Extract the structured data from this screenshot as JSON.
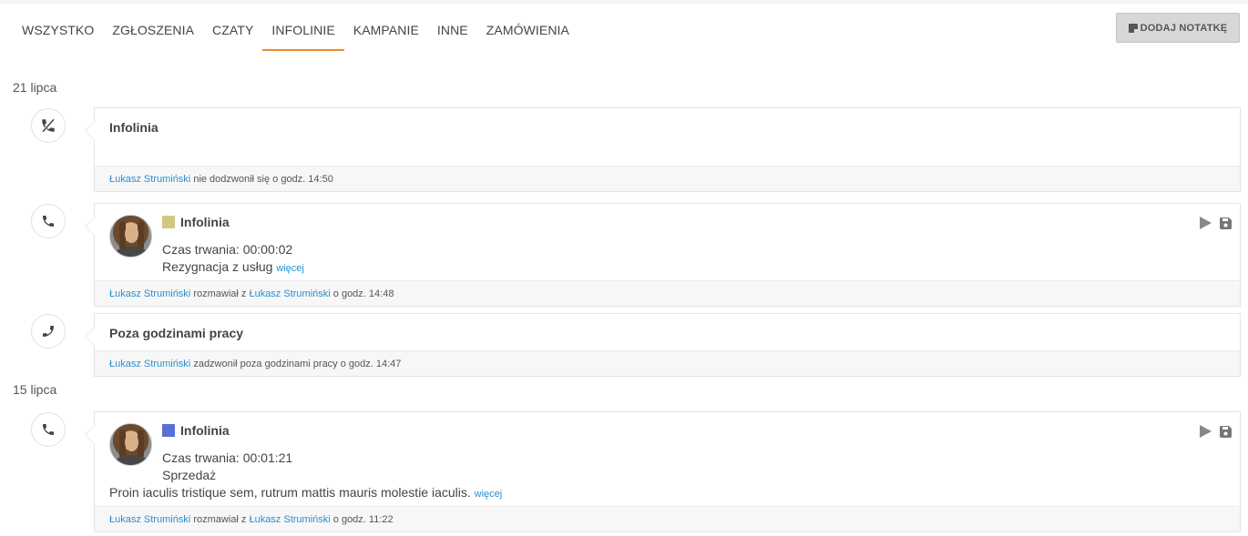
{
  "tabs": [
    {
      "label": "WSZYSTKO"
    },
    {
      "label": "ZGŁOSZENIA"
    },
    {
      "label": "CZATY"
    },
    {
      "label": "INFOLINIE",
      "active": true
    },
    {
      "label": "KAMPANIE"
    },
    {
      "label": "INNE"
    },
    {
      "label": "ZAMÓWIENIA"
    }
  ],
  "note_button": {
    "label": "DODAJ NOTATKĘ",
    "icon": "note-icon"
  },
  "colors": {
    "accent": "#f08a2e",
    "link": "#2a8fcf",
    "tag_yellow": "#d3c781",
    "tag_blue": "#5a6fd6"
  },
  "groups": [
    {
      "date": "21 lipca",
      "items": [
        {
          "icon": "missed-call-icon",
          "title": "Infolinia",
          "footer": {
            "user": "Łukasz Strumiński",
            "text": " nie dodzwonił się o godz. 14:50"
          }
        },
        {
          "icon": "phone-icon",
          "title": "Infolinia",
          "tag_color": "#d3c781",
          "duration": "Czas trwania: 00:00:02",
          "category": "Rezygnacja z usług",
          "more": "więcej",
          "footer": {
            "user": "Łukasz Strumiński",
            "mid": " rozmawiał z ",
            "user2": "Łukasz Strumiński",
            "text": " o godz. 14:48"
          }
        },
        {
          "icon": "outgoing-call-icon",
          "title": "Poza godzinami pracy",
          "footer": {
            "user": "Łukasz Strumiński",
            "text": " zadzwonił poza godzinami pracy o godz. 14:47"
          }
        }
      ]
    },
    {
      "date": "15 lipca",
      "items": [
        {
          "icon": "phone-icon",
          "title": "Infolinia",
          "tag_color": "#5a6fd6",
          "duration": "Czas trwania: 00:01:21",
          "category": "Sprzedaż",
          "note": "Proin iaculis tristique sem, rutrum mattis mauris molestie iaculis.",
          "more": "więcej",
          "footer": {
            "user": "Łukasz Strumiński",
            "mid": " rozmawiał z ",
            "user2": "Łukasz Strumiński",
            "text": " o godz. 11:22"
          }
        }
      ]
    }
  ]
}
